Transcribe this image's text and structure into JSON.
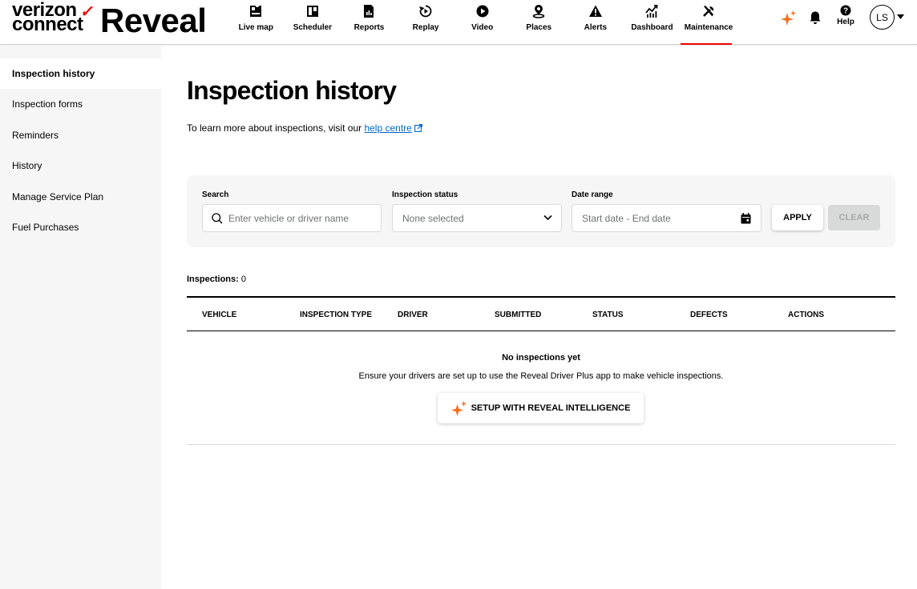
{
  "brand": {
    "line1": "verizon",
    "line2": "connect",
    "product": "Reveal"
  },
  "nav": [
    {
      "label": "Live map",
      "icon": "live-map-icon"
    },
    {
      "label": "Scheduler",
      "icon": "scheduler-icon"
    },
    {
      "label": "Reports",
      "icon": "reports-icon"
    },
    {
      "label": "Replay",
      "icon": "replay-icon"
    },
    {
      "label": "Video",
      "icon": "video-icon"
    },
    {
      "label": "Places",
      "icon": "places-icon"
    },
    {
      "label": "Alerts",
      "icon": "alerts-icon"
    },
    {
      "label": "Dashboard",
      "icon": "dashboard-icon"
    },
    {
      "label": "Maintenance",
      "icon": "maintenance-icon",
      "active": true
    }
  ],
  "header_right": {
    "help_label": "Help",
    "avatar_initials": "LS"
  },
  "sidebar": {
    "items": [
      {
        "label": "Inspection history",
        "active": true
      },
      {
        "label": "Inspection forms"
      },
      {
        "label": "Reminders"
      },
      {
        "label": "History"
      },
      {
        "label": "Manage Service Plan"
      },
      {
        "label": "Fuel Purchases"
      }
    ]
  },
  "page": {
    "title": "Inspection history",
    "intro_text": "To learn more about inspections, visit our ",
    "help_link": "help centre"
  },
  "filters": {
    "search_label": "Search",
    "search_placeholder": "Enter vehicle or driver name",
    "status_label": "Inspection status",
    "status_value": "None selected",
    "date_label": "Date range",
    "date_placeholder": "Start date - End date",
    "apply_label": "APPLY",
    "clear_label": "CLEAR"
  },
  "results": {
    "count_label": "Inspections:",
    "count_value": "0"
  },
  "table": {
    "columns": [
      "VEHICLE",
      "INSPECTION TYPE",
      "DRIVER",
      "SUBMITTED",
      "STATUS",
      "DEFECTS",
      "ACTIONS"
    ]
  },
  "empty_state": {
    "title": "No inspections yet",
    "description": "Ensure your drivers are set up to use the Reveal Driver Plus app to make vehicle inspections.",
    "button_label": "SETUP WITH REVEAL INTELLIGENCE"
  },
  "colors": {
    "accent": "#ee0000",
    "link": "#0066cc",
    "sparkle": "#f36f21",
    "panel": "#f6f6f6"
  }
}
